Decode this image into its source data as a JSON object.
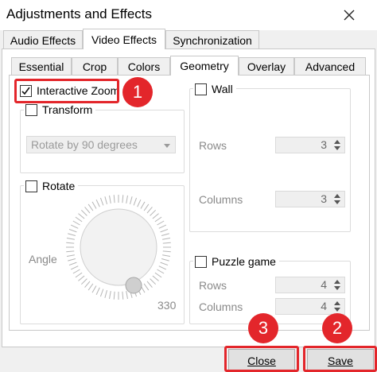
{
  "window": {
    "title": "Adjustments and Effects"
  },
  "outer_tabs": [
    {
      "label": "Audio Effects"
    },
    {
      "label": "Video Effects"
    },
    {
      "label": "Synchronization"
    }
  ],
  "inner_tabs": [
    {
      "label": "Essential"
    },
    {
      "label": "Crop"
    },
    {
      "label": "Colors"
    },
    {
      "label": "Geometry"
    },
    {
      "label": "Overlay"
    },
    {
      "label": "Advanced"
    }
  ],
  "geometry": {
    "interactive_zoom": {
      "label": "Interactive Zoom",
      "checked": true
    },
    "transform": {
      "label": "Transform",
      "checked": false,
      "dropdown": "Rotate by 90 degrees"
    },
    "rotate": {
      "label": "Rotate",
      "checked": false,
      "angle_label": "Angle",
      "angle_value": "330"
    },
    "wall": {
      "label": "Wall",
      "checked": false,
      "rows_label": "Rows",
      "rows_value": "3",
      "columns_label": "Columns",
      "columns_value": "3"
    },
    "puzzle": {
      "label": "Puzzle game",
      "checked": false,
      "rows_label": "Rows",
      "rows_value": "4",
      "columns_label": "Columns",
      "columns_value": "4"
    }
  },
  "buttons": {
    "close": "Close",
    "save": "Save"
  },
  "annotations": {
    "badge1": "1",
    "badge2": "2",
    "badge3": "3",
    "color": "#e3262b"
  }
}
